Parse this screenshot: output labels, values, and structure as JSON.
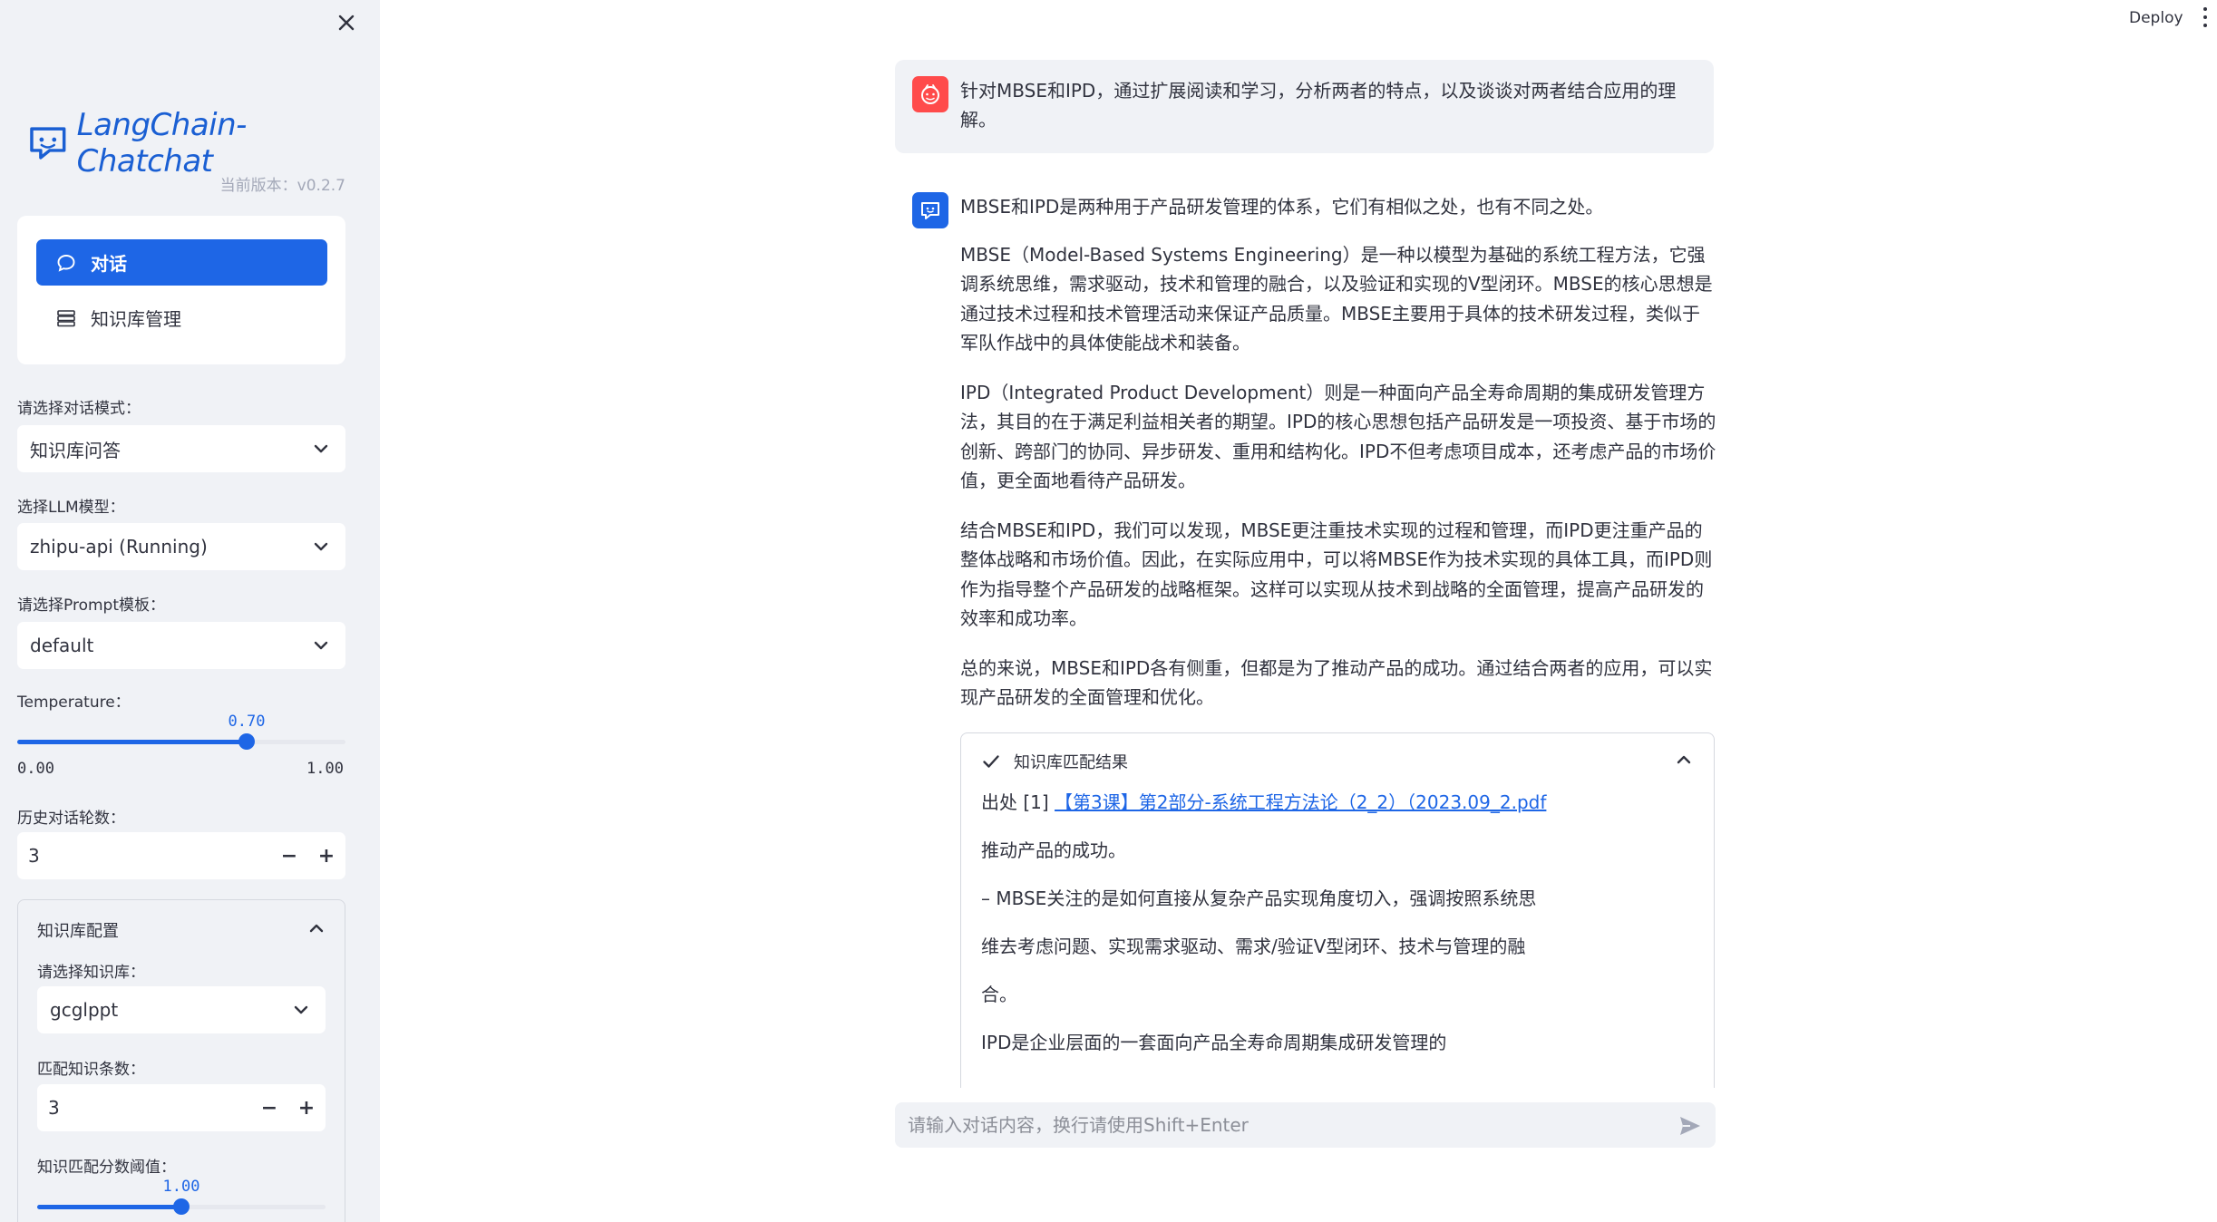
{
  "sidebar": {
    "logo_text": "LangChain-Chatchat",
    "version": "当前版本：v0.2.7",
    "menu": [
      {
        "label": "对话",
        "active": true
      },
      {
        "label": "知识库管理",
        "active": false
      }
    ],
    "dialogue_mode": {
      "label": "请选择对话模式：",
      "value": "知识库问答"
    },
    "llm_model": {
      "label": "选择LLM模型：",
      "value": "zhipu-api (Running)"
    },
    "prompt_template": {
      "label": "请选择Prompt模板：",
      "value": "default"
    },
    "temperature": {
      "label": "Temperature：",
      "value": "0.70",
      "min": "0.00",
      "max": "1.00",
      "fraction": 0.7
    },
    "history_rounds": {
      "label": "历史对话轮数：",
      "value": "3"
    },
    "kb_config": {
      "title": "知识库配置",
      "kb_select": {
        "label": "请选择知识库：",
        "value": "gcglppt"
      },
      "match_count": {
        "label": "匹配知识条数：",
        "value": "3"
      },
      "score_threshold": {
        "label": "知识匹配分数阈值：",
        "value": "1.00",
        "fraction": 0.5
      }
    }
  },
  "header": {
    "deploy_label": "Deploy"
  },
  "chat": {
    "user_message": "针对MBSE和IPD，通过扩展阅读和学习，分析两者的特点，以及谈谈对两者结合应用的理解。",
    "bot_paragraphs": [
      "MBSE和IPD是两种用于产品研发管理的体系，它们有相似之处，也有不同之处。",
      "MBSE（Model-Based Systems Engineering）是一种以模型为基础的系统工程方法，它强调系统思维，需求驱动，技术和管理的融合，以及验证和实现的V型闭环。MBSE的核心思想是通过技术过程和技术管理活动来保证产品质量。MBSE主要用于具体的技术研发过程，类似于军队作战中的具体使能战术和装备。",
      "IPD（Integrated Product Development）则是一种面向产品全寿命周期的集成研发管理方法，其目的在于满足利益相关者的期望。IPD的核心思想包括产品研发是一项投资、基于市场的创新、跨部门的协同、异步研发、重用和结构化。IPD不但考虑项目成本，还考虑产品的市场价值，更全面地看待产品研发。",
      "结合MBSE和IPD，我们可以发现，MBSE更注重技术实现的过程和管理，而IPD更注重产品的整体战略和市场价值。因此，在实际应用中，可以将MBSE作为技术实现的具体工具，而IPD则作为指导整个产品研发的战略框架。这样可以实现从技术到战略的全面管理，提高产品研发的效率和成功率。",
      "总的来说，MBSE和IPD各有侧重，但都是为了推动产品的成功。通过结合两者的应用，可以实现产品研发的全面管理和优化。"
    ],
    "kb_result": {
      "title": "知识库匹配结果",
      "source_prefix": "出处 [1] ",
      "source_link": "【第3课】第2部分-系统工程方法论（2_2）（2023.09_2.pdf",
      "lines": [
        "推动产品的成功。",
        "– MBSE关注的是如何直接从复杂产品实现角度切入，强调按照系统思",
        "维去考虑问题、实现需求驱动、需求/验证V型闭环、技术与管理的融",
        "合。",
        "IPD是企业层面的一套面向产品全寿命周期集成研发管理的"
      ]
    },
    "input_placeholder": "请输入对话内容，换行请使用Shift+Enter"
  }
}
